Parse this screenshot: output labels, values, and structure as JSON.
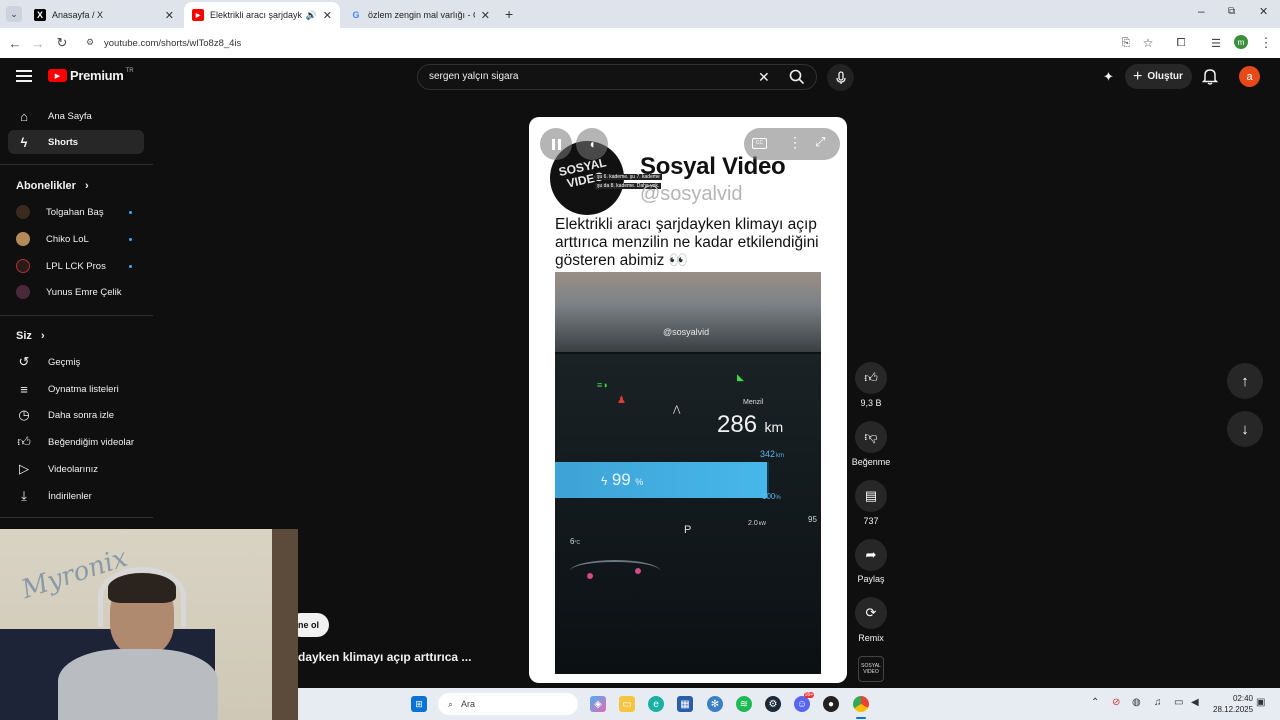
{
  "browser": {
    "tabs": [
      {
        "title": "Anasayfa / X",
        "icon": "x-logo-icon"
      },
      {
        "title": "Elektrikli aracı şarjdayken kl",
        "icon": "youtube-icon"
      },
      {
        "title": "özlem zengin mal varlığı - Goo",
        "icon": "google-icon"
      }
    ],
    "url": "youtube.com/shorts/wlTo8z8_4is"
  },
  "youtube": {
    "logo": "Premium",
    "logo_region": "TR",
    "search_value": "sergen yalçın sigara",
    "create_label": "Oluştur",
    "account_initial": "a",
    "account_color": "#e64a19"
  },
  "sidebar": {
    "home": "Ana Sayfa",
    "shorts": "Shorts",
    "subscriptions_title": "Abonelikler",
    "subscriptions": [
      {
        "name": "Tolgahan Baş",
        "color": "#3a2a20"
      },
      {
        "name": "Chiko LoL",
        "color": "#b48a5a"
      },
      {
        "name": "LPL LCK Pros",
        "color": "#2a1a1a"
      },
      {
        "name": "Yunus Emre Çelik",
        "color": "#4a2a3a"
      }
    ],
    "you_title": "Siz",
    "you_items": [
      "Geçmiş",
      "Oynatma listeleri",
      "Daha sonra izle",
      "Beğendiğim videolar",
      "Videolarınız",
      "İndirilenler"
    ]
  },
  "short": {
    "channel_name": "Sosyal Video",
    "channel_handle": "@sosyalvid",
    "logo_text": "SOSYAL VIDEO",
    "logo_subtext_lines": [
      "şu 6. kademe. şu 7. kademe",
      "şu da 8. kademe. Daha yok."
    ],
    "caption": "Elektrikli aracı şarjdayken klimayı açıp arttırıca menzilin ne kadar etkilendiğini gösteren abimiz 👀",
    "watermark": "@sosyalvid",
    "dashboard": {
      "range_label": "Menzil",
      "range": "286",
      "range_unit": "km",
      "max_range": "342",
      "max_unit": "km",
      "battery": "99",
      "battery_unit": "%",
      "battery_percent": 99,
      "full_label": "100",
      "full_unit": "%",
      "gear": "P",
      "temp": "6",
      "temp_unit": "°C",
      "power": "2.0",
      "power_unit": "kW",
      "edge_number": "95"
    },
    "title_overlay": "dayken klimayı açıp arttırıca ...",
    "subscribe_partial": "ne ol"
  },
  "actions": {
    "like_count": "9,3 B",
    "dislike_label": "Beğenme",
    "comment_count": "737",
    "share_label": "Paylaş",
    "remix_label": "Remix"
  },
  "webcam": {
    "wall_text": "Myronix"
  },
  "taskbar": {
    "search_placeholder": "Ara",
    "time": "02:40",
    "date": "28.12.2025",
    "badge_count": "99+"
  }
}
